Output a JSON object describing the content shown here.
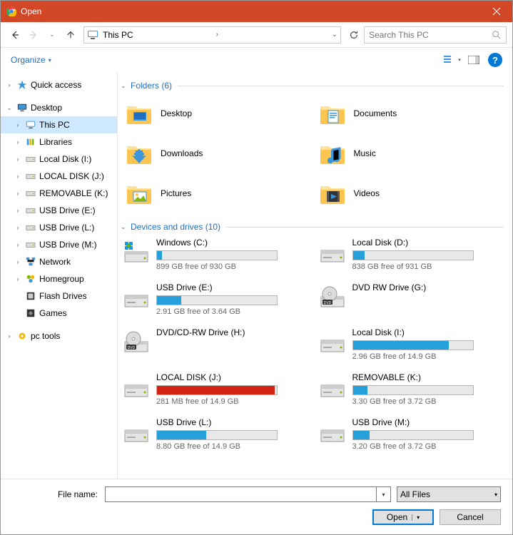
{
  "window": {
    "title": "Open"
  },
  "nav": {
    "breadcrumb_text": "This PC",
    "search_placeholder": "Search This PC"
  },
  "toolbar": {
    "organize": "Organize"
  },
  "sidebar": {
    "items": [
      {
        "label": "Quick access",
        "depth": 0,
        "exp": "›",
        "icon": "star"
      },
      {
        "label": "Desktop",
        "depth": 0,
        "exp": "⌄",
        "icon": "monitor"
      },
      {
        "label": "This PC",
        "depth": 1,
        "exp": "›",
        "icon": "pc",
        "selected": true
      },
      {
        "label": "Libraries",
        "depth": 1,
        "exp": "›",
        "icon": "library"
      },
      {
        "label": "Local Disk (I:)",
        "depth": 1,
        "exp": "›",
        "icon": "hdd"
      },
      {
        "label": "LOCAL DISK (J:)",
        "depth": 1,
        "exp": "›",
        "icon": "hdd"
      },
      {
        "label": "REMOVABLE (K:)",
        "depth": 1,
        "exp": "›",
        "icon": "hdd"
      },
      {
        "label": "USB Drive (E:)",
        "depth": 1,
        "exp": "›",
        "icon": "hdd"
      },
      {
        "label": "USB Drive (L:)",
        "depth": 1,
        "exp": "›",
        "icon": "hdd"
      },
      {
        "label": "USB Drive (M:)",
        "depth": 1,
        "exp": "›",
        "icon": "hdd"
      },
      {
        "label": "Network",
        "depth": 1,
        "exp": "›",
        "icon": "network"
      },
      {
        "label": "Homegroup",
        "depth": 1,
        "exp": "›",
        "icon": "homegroup"
      },
      {
        "label": "Flash Drives",
        "depth": 1,
        "exp": "",
        "icon": "flash"
      },
      {
        "label": "Games",
        "depth": 1,
        "exp": "",
        "icon": "games"
      },
      {
        "label": "pc tools",
        "depth": 0,
        "exp": "›",
        "icon": "gear"
      }
    ]
  },
  "groups": {
    "folders_header": "Folders (6)",
    "drives_header": "Devices and drives (10)"
  },
  "folders": [
    {
      "name": "Desktop",
      "icon": "desktop"
    },
    {
      "name": "Documents",
      "icon": "documents"
    },
    {
      "name": "Downloads",
      "icon": "downloads"
    },
    {
      "name": "Music",
      "icon": "music"
    },
    {
      "name": "Pictures",
      "icon": "pictures"
    },
    {
      "name": "Videos",
      "icon": "videos"
    }
  ],
  "drives": [
    {
      "name": "Windows (C:)",
      "free": "899 GB free of 930 GB",
      "pct": 4,
      "color": "blue",
      "icon": "os"
    },
    {
      "name": "Local Disk (D:)",
      "free": "838 GB free of 931 GB",
      "pct": 10,
      "color": "blue",
      "icon": "hdd"
    },
    {
      "name": "USB Drive (E:)",
      "free": "2.91 GB free of 3.64 GB",
      "pct": 20,
      "color": "blue",
      "icon": "hdd"
    },
    {
      "name": "DVD RW Drive (G:)",
      "free": "",
      "pct": -1,
      "color": "",
      "icon": "dvd"
    },
    {
      "name": "DVD/CD-RW Drive (H:)",
      "free": "",
      "pct": -1,
      "color": "",
      "icon": "dvd"
    },
    {
      "name": "Local Disk (I:)",
      "free": "2.96 GB free of 14.9 GB",
      "pct": 80,
      "color": "blue",
      "icon": "hdd"
    },
    {
      "name": "LOCAL DISK (J:)",
      "free": "281 MB free of 14.9 GB",
      "pct": 98,
      "color": "red",
      "icon": "hdd"
    },
    {
      "name": "REMOVABLE (K:)",
      "free": "3.30 GB free of 3.72 GB",
      "pct": 12,
      "color": "blue",
      "icon": "hdd"
    },
    {
      "name": "USB Drive (L:)",
      "free": "8.80 GB free of 14.9 GB",
      "pct": 41,
      "color": "blue",
      "icon": "hdd"
    },
    {
      "name": "USB Drive (M:)",
      "free": "3.20 GB free of 3.72 GB",
      "pct": 14,
      "color": "blue",
      "icon": "hdd"
    }
  ],
  "footer": {
    "filename_label": "File name:",
    "filter": "All Files",
    "open": "Open",
    "cancel": "Cancel"
  }
}
